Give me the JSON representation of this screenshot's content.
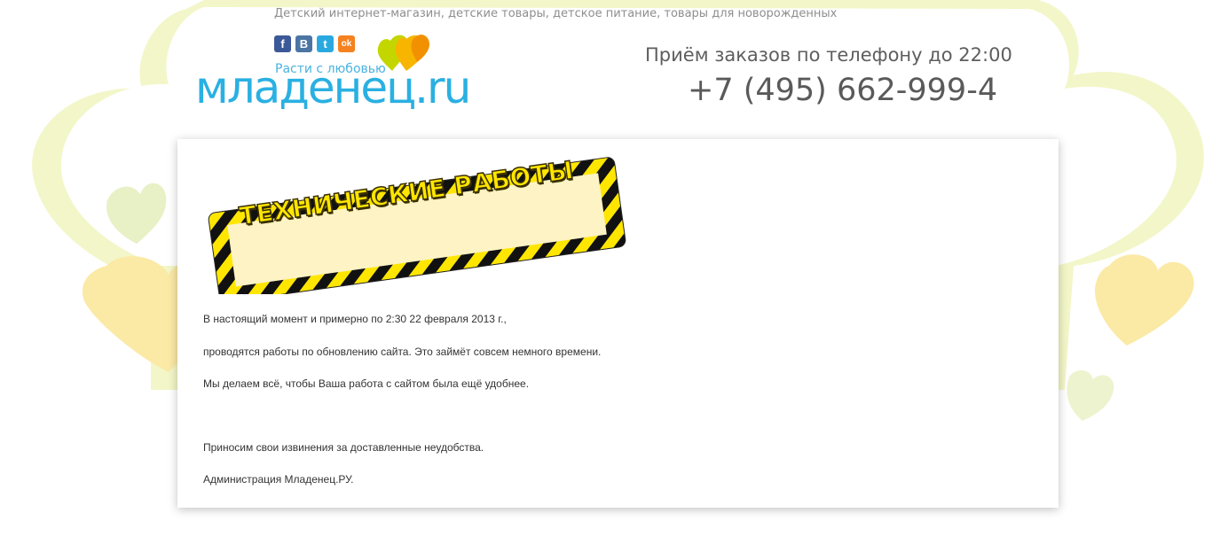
{
  "header": {
    "tagline": "Детский интернет-магазин, детские товары, детское питание, товары для новорожденных",
    "logo_slogan": "Расти с любовью",
    "logo_text": "младенец.ru",
    "order_label": "Приём заказов по телефону до 22:00",
    "phone": "+7 (495) 662-999-4"
  },
  "social": [
    {
      "name": "facebook",
      "glyph": "f",
      "color": "#3b5998"
    },
    {
      "name": "vkontakte",
      "glyph": "B",
      "color": "#4c75a3"
    },
    {
      "name": "twitter",
      "glyph": "t",
      "color": "#2aa9e0"
    },
    {
      "name": "odnoklassniki",
      "glyph": "ok",
      "color": "#f58220"
    }
  ],
  "banner": {
    "title": "ТЕХНИЧЕСКИЕ РАБОТЫ"
  },
  "message": {
    "line1": "В настоящий момент и примерно по 2:30 22 февраля 2013 г.,",
    "line2": "проводятся работы по обновлению сайта. Это займёт совсем немного времени.",
    "line3": "Мы делаем всё, чтобы Ваша работа с сайтом была ещё удобнее.",
    "line4": "Приносим свои извинения за доставленные неудобства.",
    "line5": "Администрация Младенец.РУ."
  },
  "colors": {
    "brand_blue": "#2ab0e2",
    "heart_yellow": "#fbe9a6",
    "heart_green": "#dbe7a0"
  }
}
